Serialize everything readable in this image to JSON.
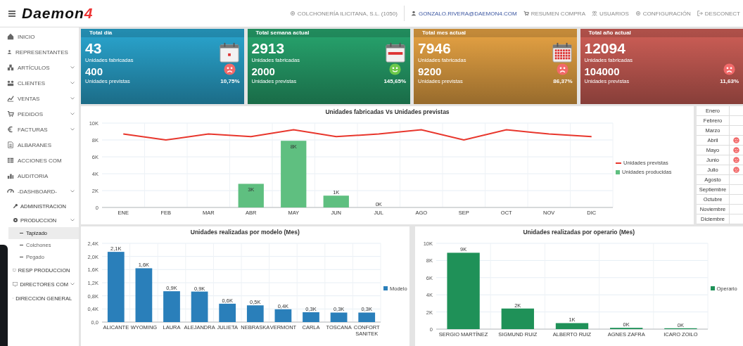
{
  "header": {
    "logo": {
      "text": "Daemon",
      "accent": "4"
    },
    "company": "COLCHONERÍA ILICITANA, S.L. (1050)",
    "user": "GONZALO.RIVERA@DAEMON4.COM",
    "links": [
      {
        "label": "RESUMEN COMPRA"
      },
      {
        "label": "USUARIOS"
      },
      {
        "label": "CONFIGURACIÓN"
      },
      {
        "label": "DESCONECT"
      }
    ]
  },
  "sidebar": {
    "items": [
      {
        "label": "INICIO",
        "expandable": false
      },
      {
        "label": "REPRESENTANTES",
        "expandable": false
      },
      {
        "label": "ARTÍCULOS",
        "expandable": true
      },
      {
        "label": "CLIENTES",
        "expandable": true
      },
      {
        "label": "VENTAS",
        "expandable": true
      },
      {
        "label": "PEDIDOS",
        "expandable": true
      },
      {
        "label": "FACTURAS",
        "expandable": true
      },
      {
        "label": "ALBARANES",
        "expandable": false
      },
      {
        "label": "ACCIONES COM",
        "expandable": false
      },
      {
        "label": "AUDITORIA",
        "expandable": false
      },
      {
        "label": "-DASHBOARD-",
        "expandable": true,
        "children": [
          {
            "label": "ADMINISTRACION",
            "expandable": false
          },
          {
            "label": "PRODUCCION",
            "expandable": true,
            "children": [
              {
                "label": "Tapizado",
                "selected": true
              },
              {
                "label": "Colchones",
                "selected": false
              },
              {
                "label": "Pegado",
                "selected": false
              }
            ]
          },
          {
            "label": "RESP PRODUCCION",
            "expandable": false
          },
          {
            "label": "DIRECTORES COM",
            "expandable": true
          },
          {
            "label": "DIRECCION GENERAL",
            "expandable": false
          }
        ]
      }
    ]
  },
  "cards": [
    {
      "title": "Total día",
      "value": "43",
      "value_label": "Unidades fabricadas",
      "forecast": "400",
      "forecast_label": "Unidades previstas",
      "percent": "10,75%",
      "on_target": false,
      "color": "#2aa6d0"
    },
    {
      "title": "Total semana actual",
      "value": "2913",
      "value_label": "Unidades fabricadas",
      "forecast": "2000",
      "forecast_label": "Unidades previstas",
      "percent": "145,65%",
      "on_target": true,
      "color": "#27a56e"
    },
    {
      "title": "Total mes actual",
      "value": "7946",
      "value_label": "Unidades fabricadas",
      "forecast": "9200",
      "forecast_label": "Unidades previstas",
      "percent": "86,37%",
      "on_target": false,
      "color": "#e8a444"
    },
    {
      "title": "Total año actual",
      "value": "12094",
      "value_label": "Unidades fabricadas",
      "forecast": "104000",
      "forecast_label": "Unidades previstas",
      "percent": "11,63%",
      "on_target": false,
      "color": "#cf5f57"
    }
  ],
  "main_chart": {
    "chart_data": {
      "type": "bar",
      "title": "Unidades fabricadas Vs Unidades previstas",
      "categories": [
        "ENE",
        "FEB",
        "MAR",
        "ABR",
        "MAY",
        "JUN",
        "JUL",
        "AGO",
        "SEP",
        "OCT",
        "NOV",
        "DIC"
      ],
      "ylim": [
        0,
        10000
      ],
      "yticks": [
        {
          "value": 0,
          "label": "0"
        },
        {
          "value": 2000,
          "label": "2K"
        },
        {
          "value": 4000,
          "label": "4K"
        },
        {
          "value": 6000,
          "label": "6K"
        },
        {
          "value": 8000,
          "label": "8K"
        },
        {
          "value": 10000,
          "label": "10K"
        }
      ],
      "grid": true,
      "series": [
        {
          "name": "Unidades previstas",
          "type": "line",
          "color": "#e8362c",
          "values": [
            8700,
            8000,
            8700,
            8400,
            9200,
            8400,
            8700,
            9200,
            8000,
            9200,
            8700,
            8400
          ]
        },
        {
          "name": "Unidades producidas",
          "type": "bar",
          "color": "#5fbf80",
          "values": [
            null,
            null,
            null,
            2800,
            7900,
            1400,
            0,
            null,
            null,
            null,
            null,
            null
          ],
          "value_labels": [
            null,
            null,
            null,
            "3K",
            "8K",
            "1K",
            "0K",
            null,
            null,
            null,
            null,
            null
          ]
        }
      ]
    }
  },
  "months": [
    {
      "label": "Enero",
      "alert": false
    },
    {
      "label": "Febrero",
      "alert": false
    },
    {
      "label": "Marzo",
      "alert": false
    },
    {
      "label": "Abril",
      "alert": true
    },
    {
      "label": "Mayo",
      "alert": true
    },
    {
      "label": "Junio",
      "alert": true
    },
    {
      "label": "Julio",
      "alert": true
    },
    {
      "label": "Agosto",
      "alert": false
    },
    {
      "label": "Septiembre",
      "alert": false
    },
    {
      "label": "Octubre",
      "alert": false
    },
    {
      "label": "Noviembre",
      "alert": false
    },
    {
      "label": "Diciembre",
      "alert": false
    }
  ],
  "model_chart": {
    "chart_data": {
      "type": "bar",
      "title": "Unidades realizadas por modelo (Mes)",
      "categories": [
        "ALICANTE",
        "WYOMING",
        "LAURA",
        "ALEJANDRA",
        "JULIETA",
        "NEBRASKA",
        "VERMONT",
        "CARLA",
        "TOSCANA",
        "CONFORT SANITEK"
      ],
      "ylim": [
        0,
        2400
      ],
      "yticks": [
        {
          "value": 0,
          "label": "0,0"
        },
        {
          "value": 400,
          "label": "0,4K"
        },
        {
          "value": 800,
          "label": "0,8K"
        },
        {
          "value": 1200,
          "label": "1,2K"
        },
        {
          "value": 1600,
          "label": "1,6K"
        },
        {
          "value": 2000,
          "label": "2,0K"
        },
        {
          "value": 2400,
          "label": "2,4K"
        }
      ],
      "grid": true,
      "series": [
        {
          "name": "Modelo",
          "color": "#2a7fba",
          "values": [
            2140,
            1640,
            940,
            930,
            560,
            510,
            390,
            300,
            290,
            290
          ],
          "value_labels": [
            "2,1K",
            "1,6K",
            "0,9K",
            "0,9K",
            "0,6K",
            "0,5K",
            "0,4K",
            "0,3K",
            "0,3K",
            "0,3K"
          ]
        }
      ]
    }
  },
  "operator_chart": {
    "chart_data": {
      "type": "bar",
      "title": "Unidades realizadas por operario (Mes)",
      "categories": [
        "SERGIO MARTÍNEZ",
        "SIGMUND RUIZ",
        "ALBERTO RUIZ",
        "AGNES ZAFRA",
        "ICARO ZOILO"
      ],
      "ylim": [
        0,
        10000
      ],
      "yticks": [
        {
          "value": 0,
          "label": "0"
        },
        {
          "value": 2000,
          "label": "2K"
        },
        {
          "value": 4000,
          "label": "4K"
        },
        {
          "value": 6000,
          "label": "6K"
        },
        {
          "value": 8000,
          "label": "8K"
        },
        {
          "value": 10000,
          "label": "10K"
        }
      ],
      "grid": true,
      "series": [
        {
          "name": "Operario",
          "color": "#1f9158",
          "values": [
            8900,
            2400,
            700,
            150,
            100
          ],
          "value_labels": [
            "9K",
            "2K",
            "1K",
            "0K",
            "0K"
          ]
        }
      ]
    }
  }
}
